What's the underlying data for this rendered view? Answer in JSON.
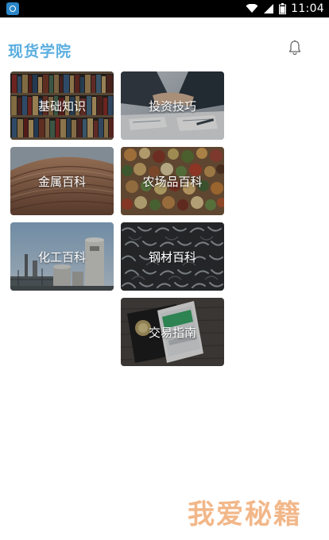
{
  "status_bar": {
    "time": "11:04"
  },
  "header": {
    "title": "现货学院",
    "bell_icon": "bell-icon"
  },
  "categories": [
    {
      "label": "基础知识",
      "image": "bookshelf"
    },
    {
      "label": "投资技巧",
      "image": "handshake-desk"
    },
    {
      "label": "金属百科",
      "image": "metal-roof"
    },
    {
      "label": "农场品百科",
      "image": "beans-grains"
    },
    {
      "label": "化工百科",
      "image": "chemical-plant"
    },
    {
      "label": "钢材百科",
      "image": "steel-rebar"
    },
    {
      "label": "交易指南",
      "image": "phone-wallet"
    }
  ],
  "watermark": "我爱秘籍",
  "colors": {
    "title": "#5aaee0",
    "status_bar": "#000000",
    "watermark": "#f2b483"
  }
}
